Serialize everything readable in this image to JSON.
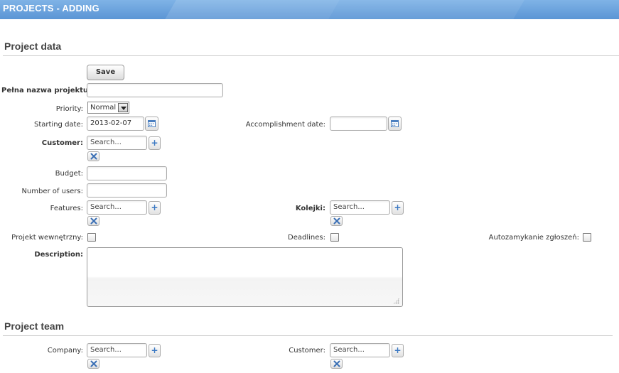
{
  "header": {
    "title": "PROJECTS - ADDING"
  },
  "project_data": {
    "section_title": "Project data",
    "save_label": "Save",
    "full_name": {
      "label": "Pełna nazwa projektu:",
      "value": ""
    },
    "priority": {
      "label": "Priority:",
      "value": "Normal"
    },
    "starting_date": {
      "label": "Starting date:",
      "value": "2013-02-07"
    },
    "accomplishment_date": {
      "label": "Accomplishment date:",
      "value": ""
    },
    "customer": {
      "label": "Customer:",
      "placeholder": "Search..."
    },
    "budget": {
      "label": "Budget:",
      "value": ""
    },
    "number_of_users": {
      "label": "Number of users:",
      "value": ""
    },
    "features": {
      "label": "Features:",
      "placeholder": "Search..."
    },
    "kolejki": {
      "label": "Kolejki:",
      "placeholder": "Search..."
    },
    "internal_project": {
      "label": "Projekt wewnętrzny:",
      "checked": false
    },
    "deadlines": {
      "label": "Deadlines:",
      "checked": false
    },
    "auto_close": {
      "label": "Autozamykanie zgłoszeń:",
      "checked": false
    },
    "description": {
      "label": "Description:",
      "value": ""
    }
  },
  "project_team": {
    "section_title": "Project team",
    "company": {
      "label": "Company:",
      "placeholder": "Search..."
    },
    "customer": {
      "label": "Customer:",
      "placeholder": "Search..."
    }
  },
  "icons": {
    "calendar": "calendar-icon",
    "add": "plus-icon",
    "remove": "close-icon",
    "dropdown": "chevron-down-icon"
  },
  "colors": {
    "header_bg": "#5b95d5",
    "plus_icon": "#3a78c3",
    "remove_icon": "#3a6fb5"
  }
}
